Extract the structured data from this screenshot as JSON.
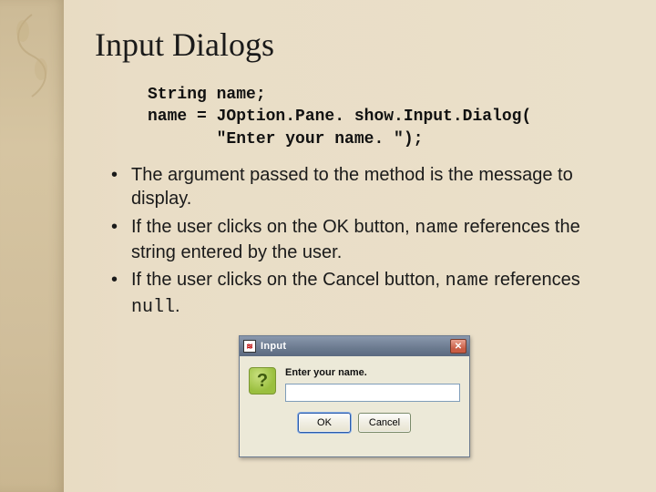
{
  "title": "Input Dialogs",
  "code": {
    "line1": "String name;",
    "line2": "name = JOption.Pane. show.Input.Dialog(",
    "line3": "       \"Enter your name. \");"
  },
  "bullets": {
    "b1_pre": "The argument passed to the method is the message to display.",
    "b2_pre": "If the user clicks on the OK button, ",
    "b2_code": "name",
    "b2_post": " references the string entered by the user.",
    "b3_pre": "If the user clicks on the Cancel button, ",
    "b3_code1": "name",
    "b3_mid": " references ",
    "b3_code2": "null",
    "b3_post": "."
  },
  "dialog": {
    "title": "Input",
    "label": "Enter your name.",
    "ok": "OK",
    "cancel": "Cancel",
    "question_mark": "?",
    "close_glyph": "✕",
    "java_glyph": "≋"
  }
}
